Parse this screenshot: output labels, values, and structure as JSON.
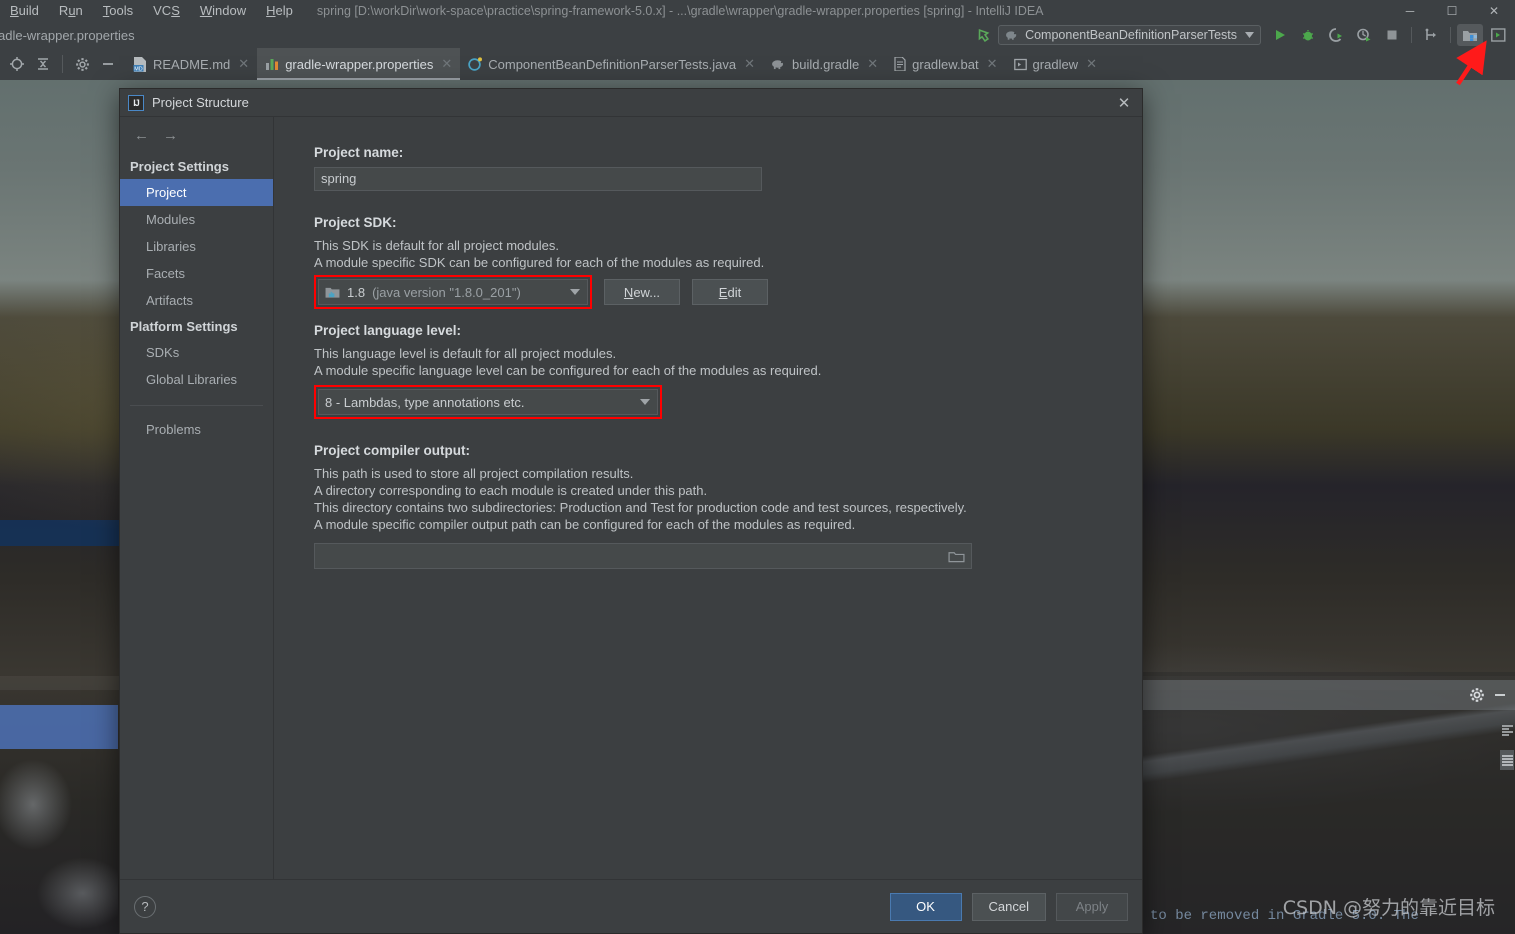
{
  "window": {
    "title": "spring [D:\\workDir\\work-space\\practice\\spring-framework-5.0.x] - ...\\gradle\\wrapper\\gradle-wrapper.properties [spring] - IntelliJ IDEA",
    "minimize": "─",
    "maximize": "☐",
    "close": "✕"
  },
  "menubar": {
    "items": [
      {
        "label": "Build",
        "mnemonic": "B"
      },
      {
        "label": "Run",
        "mnemonic": "R"
      },
      {
        "label": "Tools",
        "mnemonic": "T"
      },
      {
        "label": "VCS",
        "mnemonic": "S"
      },
      {
        "label": "Window",
        "mnemonic": "W"
      },
      {
        "label": "Help",
        "mnemonic": "H"
      }
    ]
  },
  "navbar": {
    "breadcrumb": "adle-wrapper.properties"
  },
  "toolbar": {
    "run_configuration": "ComponentBeanDefinitionParserTests",
    "icons": [
      "update-project-icon",
      "run-icon",
      "debug-icon",
      "run-with-coverage-icon",
      "profile-icon",
      "stop-icon",
      "git-branch-icon",
      "project-structure-icon",
      "search-everywhere-icon"
    ]
  },
  "tool_icons": [
    "locate-icon",
    "collapse-all-icon",
    "settings-gear-icon",
    "hide-icon"
  ],
  "tabs": [
    {
      "label": "README.md",
      "icon": "markdown-file-icon",
      "active": false
    },
    {
      "label": "gradle-wrapper.properties",
      "icon": "properties-file-icon",
      "active": true
    },
    {
      "label": "ComponentBeanDefinitionParserTests.java",
      "icon": "java-class-icon",
      "active": false
    },
    {
      "label": "build.gradle",
      "icon": "gradle-file-icon",
      "active": false
    },
    {
      "label": "gradlew.bat",
      "icon": "bat-file-icon",
      "active": false
    },
    {
      "label": "gradlew",
      "icon": "shell-file-icon",
      "active": false
    }
  ],
  "editor": {
    "code_fragment": "to be removed in Gradle 5.0. The",
    "watermark": "CSDN @努力的靠近目标"
  },
  "dialog": {
    "title": "Project Structure",
    "close": "✕",
    "nav": {
      "back": "←",
      "forward": "→"
    },
    "sidebar": {
      "groups": [
        {
          "title": "Project Settings",
          "items": [
            {
              "label": "Project",
              "active": true
            },
            {
              "label": "Modules",
              "active": false
            },
            {
              "label": "Libraries",
              "active": false
            },
            {
              "label": "Facets",
              "active": false
            },
            {
              "label": "Artifacts",
              "active": false
            }
          ]
        },
        {
          "title": "Platform Settings",
          "items": [
            {
              "label": "SDKs",
              "active": false
            },
            {
              "label": "Global Libraries",
              "active": false
            }
          ]
        }
      ],
      "extra": [
        {
          "label": "Problems",
          "active": false
        }
      ]
    },
    "project_name": {
      "label": "Project name:",
      "value": "spring"
    },
    "project_sdk": {
      "label": "Project SDK:",
      "desc_line1": "This SDK is default for all project modules.",
      "desc_line2": "A module specific SDK can be configured for each of the modules as required.",
      "selected_version": "1.8",
      "selected_detail": "(java version \"1.8.0_201\")",
      "new_button": "New...",
      "new_button_mnemonic": "N",
      "edit_button": "Edit",
      "edit_button_mnemonic": "E",
      "highlight_color": "#ff0000"
    },
    "project_language_level": {
      "label": "Project language level:",
      "desc_line1": "This language level is default for all project modules.",
      "desc_line2": "A module specific language level can be configured for each of the modules as required.",
      "selected": "8 - Lambdas, type annotations etc.",
      "highlight_color": "#ff0000"
    },
    "project_compiler_output": {
      "label": "Project compiler output:",
      "desc_line1": "This path is used to store all project compilation results.",
      "desc_line2": "A directory corresponding to each module is created under this path.",
      "desc_line3": "This directory contains two subdirectories: Production and Test for production code and test sources, respectively.",
      "desc_line4": "A module specific compiler output path can be configured for each of the modules as required.",
      "value": "",
      "browse_icon": "folder-browse-icon"
    },
    "footer": {
      "help": "?",
      "ok": "OK",
      "cancel": "Cancel",
      "apply": "Apply"
    }
  },
  "annotation": {
    "arrow_color": "#ff1a1a"
  },
  "colors": {
    "accent": "#4b6eaf",
    "primary_button": "#365880",
    "dialog_bg": "#3c3f41",
    "chrome_bg": "#3c4043",
    "highlight": "#ff0000"
  }
}
